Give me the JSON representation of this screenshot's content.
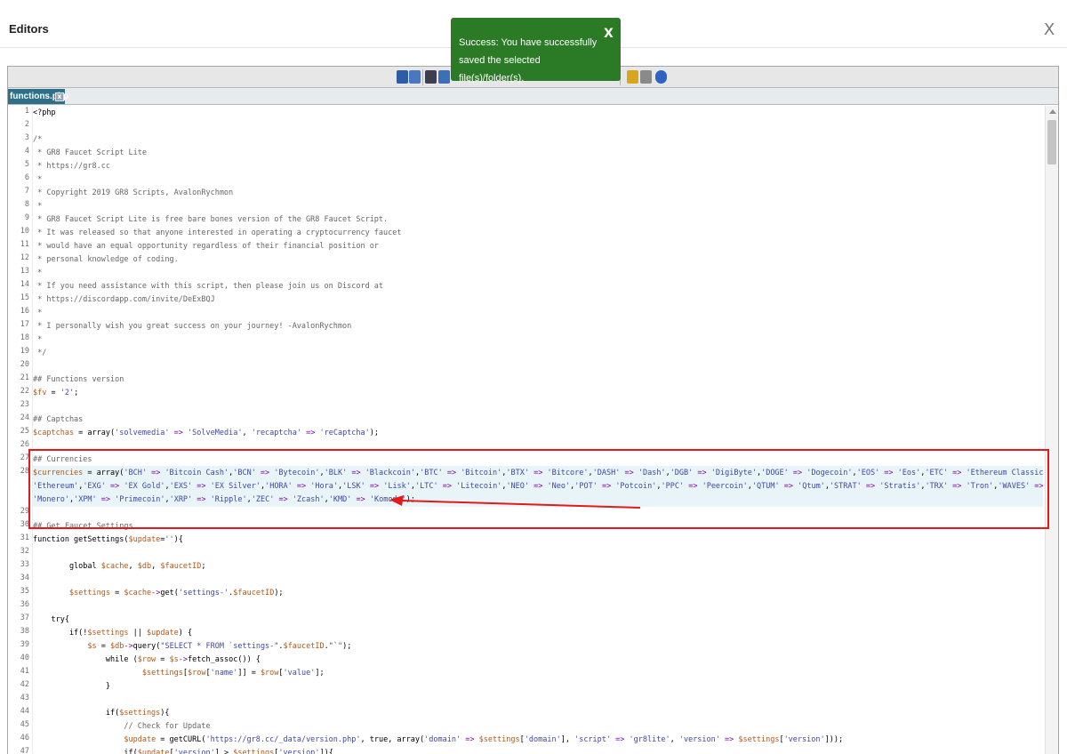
{
  "window": {
    "title": "Editors",
    "close_label": "X"
  },
  "toast": {
    "message": "Success: You have successfully saved the selected file(s)/folder(s).",
    "close_label": "X",
    "color": "#2b7a26"
  },
  "tab": {
    "label": "functions.php",
    "close_label": "x"
  },
  "toolbar_icons": [
    "save-icon",
    "save-all-icon",
    "search-icon",
    "replace-icon",
    "spellcheck-icon",
    "edit-icon",
    "help-icon"
  ],
  "highlight_color": "#e21a1a",
  "line_numbers": [
    "1",
    "2",
    "3",
    "4",
    "5",
    "6",
    "7",
    "8",
    "9",
    "10",
    "11",
    "12",
    "13",
    "14",
    "15",
    "16",
    "17",
    "18",
    "19",
    "20",
    "21",
    "22",
    "23",
    "24",
    "25",
    "26",
    "27",
    "28",
    "",
    "",
    "29",
    "30",
    "31",
    "32",
    "33",
    "34",
    "35",
    "36",
    "37",
    "38",
    "39",
    "40",
    "41",
    "42",
    "43",
    "44",
    "45",
    "46",
    "47"
  ],
  "code": [
    [
      [
        "k",
        "<?php"
      ]
    ],
    [],
    [
      [
        "c",
        "/*"
      ]
    ],
    [
      [
        "c",
        " * GR8 Faucet Script Lite"
      ]
    ],
    [
      [
        "c",
        " * https://gr8.cc"
      ]
    ],
    [
      [
        "c",
        " *"
      ]
    ],
    [
      [
        "c",
        " * Copyright 2019 GR8 Scripts, AvalonRychmon"
      ]
    ],
    [
      [
        "c",
        " *"
      ]
    ],
    [
      [
        "c",
        " * GR8 Faucet Script Lite is free bare bones version of the GR8 Faucet Script."
      ]
    ],
    [
      [
        "c",
        " * It was released so that anyone interested in operating a cryptocurrency faucet"
      ]
    ],
    [
      [
        "c",
        " * would have an equal opportunity regardless of their financial position or"
      ]
    ],
    [
      [
        "c",
        " * personal knowledge of coding."
      ]
    ],
    [
      [
        "c",
        " *"
      ]
    ],
    [
      [
        "c",
        " * If you need assistance with this script, then please join us on Discord at"
      ]
    ],
    [
      [
        "c",
        " * https://discordapp.com/invite/DeExBQJ"
      ]
    ],
    [
      [
        "c",
        " *"
      ]
    ],
    [
      [
        "c",
        " * I personally wish you great success on your journey! -AvalonRychmon"
      ]
    ],
    [
      [
        "c",
        " *"
      ]
    ],
    [
      [
        "c",
        " */"
      ]
    ],
    [],
    [
      [
        "c",
        "## Functions version"
      ]
    ],
    [
      [
        "v",
        "$fv"
      ],
      [
        "k",
        " = "
      ],
      [
        "s",
        "'2'"
      ],
      [
        "k",
        ";"
      ]
    ],
    [],
    [
      [
        "c",
        "## Captchas"
      ]
    ],
    [
      [
        "v",
        "$captchas"
      ],
      [
        "k",
        " = array("
      ],
      [
        "s",
        "'solvemedia'"
      ],
      [
        "a",
        " => "
      ],
      [
        "s",
        "'SolveMedia'"
      ],
      [
        "k",
        ", "
      ],
      [
        "s",
        "'recaptcha'"
      ],
      [
        "a",
        " => "
      ],
      [
        "s",
        "'reCaptcha'"
      ],
      [
        "k",
        ");"
      ]
    ],
    [],
    [
      [
        "c",
        "## Currencies"
      ]
    ],
    [
      [
        "v",
        "$currencies"
      ],
      [
        "k",
        " = array("
      ],
      [
        "s",
        "'BCH'"
      ],
      [
        "a",
        " => "
      ],
      [
        "s",
        "'Bitcoin Cash'"
      ],
      [
        "k",
        ","
      ],
      [
        "s",
        "'BCN'"
      ],
      [
        "a",
        " => "
      ],
      [
        "s",
        "'Bytecoin'"
      ],
      [
        "k",
        ","
      ],
      [
        "s",
        "'BLK'"
      ],
      [
        "a",
        " => "
      ],
      [
        "s",
        "'Blackcoin'"
      ],
      [
        "k",
        ","
      ],
      [
        "s",
        "'BTC'"
      ],
      [
        "a",
        " => "
      ],
      [
        "s",
        "'Bitcoin'"
      ],
      [
        "k",
        ","
      ],
      [
        "s",
        "'BTX'"
      ],
      [
        "a",
        " => "
      ],
      [
        "s",
        "'Bitcore'"
      ],
      [
        "k",
        ","
      ],
      [
        "s",
        "'DASH'"
      ],
      [
        "a",
        " => "
      ],
      [
        "s",
        "'Dash'"
      ],
      [
        "k",
        ","
      ],
      [
        "s",
        "'DGB'"
      ],
      [
        "a",
        " => "
      ],
      [
        "s",
        "'DigiByte'"
      ],
      [
        "k",
        ","
      ],
      [
        "s",
        "'DOGE'"
      ],
      [
        "a",
        " => "
      ],
      [
        "s",
        "'Dogecoin'"
      ],
      [
        "k",
        ","
      ],
      [
        "s",
        "'EOS'"
      ],
      [
        "a",
        " => "
      ],
      [
        "s",
        "'Eos'"
      ],
      [
        "k",
        ","
      ],
      [
        "s",
        "'ETC'"
      ],
      [
        "a",
        " => "
      ],
      [
        "s",
        "'Ethereum Classic'"
      ],
      [
        "k",
        ","
      ],
      [
        "s",
        "'ETH'"
      ],
      [
        "a",
        " =>"
      ]
    ],
    [
      [
        "s",
        "'Ethereum'"
      ],
      [
        "k",
        ","
      ],
      [
        "s",
        "'EXG'"
      ],
      [
        "a",
        " => "
      ],
      [
        "s",
        "'EX Gold'"
      ],
      [
        "k",
        ","
      ],
      [
        "s",
        "'EXS'"
      ],
      [
        "a",
        " => "
      ],
      [
        "s",
        "'EX Silver'"
      ],
      [
        "k",
        ","
      ],
      [
        "s",
        "'HORA'"
      ],
      [
        "a",
        " => "
      ],
      [
        "s",
        "'Hora'"
      ],
      [
        "k",
        ","
      ],
      [
        "s",
        "'LSK'"
      ],
      [
        "a",
        " => "
      ],
      [
        "s",
        "'Lisk'"
      ],
      [
        "k",
        ","
      ],
      [
        "s",
        "'LTC'"
      ],
      [
        "a",
        " => "
      ],
      [
        "s",
        "'Litecoin'"
      ],
      [
        "k",
        ","
      ],
      [
        "s",
        "'NEO'"
      ],
      [
        "a",
        " => "
      ],
      [
        "s",
        "'Neo'"
      ],
      [
        "k",
        ","
      ],
      [
        "s",
        "'POT'"
      ],
      [
        "a",
        " => "
      ],
      [
        "s",
        "'Potcoin'"
      ],
      [
        "k",
        ","
      ],
      [
        "s",
        "'PPC'"
      ],
      [
        "a",
        " => "
      ],
      [
        "s",
        "'Peercoin'"
      ],
      [
        "k",
        ","
      ],
      [
        "s",
        "'QTUM'"
      ],
      [
        "a",
        " => "
      ],
      [
        "s",
        "'Qtum'"
      ],
      [
        "k",
        ","
      ],
      [
        "s",
        "'STRAT'"
      ],
      [
        "a",
        " => "
      ],
      [
        "s",
        "'Stratis'"
      ],
      [
        "k",
        ","
      ],
      [
        "s",
        "'TRX'"
      ],
      [
        "a",
        " => "
      ],
      [
        "s",
        "'Tron'"
      ],
      [
        "k",
        ","
      ],
      [
        "s",
        "'WAVES'"
      ],
      [
        "a",
        " => "
      ],
      [
        "s",
        "'Waves'"
      ],
      [
        "k",
        ","
      ],
      [
        "s",
        "'XMR'"
      ],
      [
        "a",
        " =>"
      ]
    ],
    [
      [
        "s",
        "'Monero'"
      ],
      [
        "k",
        ","
      ],
      [
        "s",
        "'XPM'"
      ],
      [
        "a",
        " => "
      ],
      [
        "s",
        "'Primecoin'"
      ],
      [
        "k",
        ","
      ],
      [
        "s",
        "'XRP'"
      ],
      [
        "a",
        " => "
      ],
      [
        "s",
        "'Ripple'"
      ],
      [
        "k",
        ","
      ],
      [
        "s",
        "'ZEC'"
      ],
      [
        "a",
        " => "
      ],
      [
        "s",
        "'Zcash'"
      ],
      [
        "k",
        ","
      ],
      [
        "s",
        "'KMD'"
      ],
      [
        "a",
        " => "
      ],
      [
        "s",
        "'Komodo'"
      ],
      [
        "k",
        ");"
      ]
    ],
    [],
    [
      [
        "c",
        "## Get Faucet Settings"
      ]
    ],
    [
      [
        "k",
        "function getSettings("
      ],
      [
        "v",
        "$update"
      ],
      [
        "k",
        "="
      ],
      [
        "s",
        "''"
      ],
      [
        "k",
        "){"
      ]
    ],
    [],
    [
      [
        "k",
        "        global "
      ],
      [
        "v",
        "$cache"
      ],
      [
        "k",
        ", "
      ],
      [
        "v",
        "$db"
      ],
      [
        "k",
        ", "
      ],
      [
        "v",
        "$faucetID"
      ],
      [
        "k",
        ";"
      ]
    ],
    [],
    [
      [
        "k",
        "        "
      ],
      [
        "v",
        "$settings"
      ],
      [
        "k",
        " = "
      ],
      [
        "v",
        "$cache"
      ],
      [
        "a",
        "->"
      ],
      [
        "k",
        "get("
      ],
      [
        "s",
        "'settings-'"
      ],
      [
        "k",
        "."
      ],
      [
        "v",
        "$faucetID"
      ],
      [
        "k",
        ");"
      ]
    ],
    [],
    [
      [
        "k",
        "    try{"
      ]
    ],
    [
      [
        "k",
        "        if(!"
      ],
      [
        "v",
        "$settings"
      ],
      [
        "k",
        " || "
      ],
      [
        "v",
        "$update"
      ],
      [
        "k",
        ") {"
      ]
    ],
    [
      [
        "k",
        "            "
      ],
      [
        "v",
        "$s"
      ],
      [
        "k",
        " = "
      ],
      [
        "v",
        "$db"
      ],
      [
        "a",
        "->"
      ],
      [
        "k",
        "query("
      ],
      [
        "s",
        "\"SELECT * FROM `settings-\""
      ],
      [
        "k",
        "."
      ],
      [
        "v",
        "$faucetID"
      ],
      [
        "k",
        "."
      ],
      [
        "s",
        "\"`\""
      ],
      [
        "k",
        ");"
      ]
    ],
    [
      [
        "k",
        "                while ("
      ],
      [
        "v",
        "$row"
      ],
      [
        "k",
        " = "
      ],
      [
        "v",
        "$s"
      ],
      [
        "a",
        "->"
      ],
      [
        "k",
        "fetch_assoc()) {"
      ]
    ],
    [
      [
        "k",
        "                        "
      ],
      [
        "v",
        "$settings"
      ],
      [
        "k",
        "["
      ],
      [
        "v",
        "$row"
      ],
      [
        "k",
        "["
      ],
      [
        "s",
        "'name'"
      ],
      [
        "k",
        "]] = "
      ],
      [
        "v",
        "$row"
      ],
      [
        "k",
        "["
      ],
      [
        "s",
        "'value'"
      ],
      [
        "k",
        "];"
      ]
    ],
    [
      [
        "k",
        "                }"
      ]
    ],
    [],
    [
      [
        "k",
        "                if("
      ],
      [
        "v",
        "$settings"
      ],
      [
        "k",
        "){"
      ]
    ],
    [
      [
        "c",
        "                    // Check for Update"
      ]
    ],
    [
      [
        "k",
        "                    "
      ],
      [
        "v",
        "$update"
      ],
      [
        "k",
        " = getCURL("
      ],
      [
        "s",
        "'https://gr8.cc/_data/version.php'"
      ],
      [
        "k",
        ", true, array("
      ],
      [
        "s",
        "'domain'"
      ],
      [
        "a",
        " => "
      ],
      [
        "v",
        "$settings"
      ],
      [
        "k",
        "["
      ],
      [
        "s",
        "'domain'"
      ],
      [
        "k",
        "], "
      ],
      [
        "s",
        "'script'"
      ],
      [
        "a",
        " => "
      ],
      [
        "s",
        "'gr8lite'"
      ],
      [
        "k",
        ", "
      ],
      [
        "s",
        "'version'"
      ],
      [
        "a",
        " => "
      ],
      [
        "v",
        "$settings"
      ],
      [
        "k",
        "["
      ],
      [
        "s",
        "'version'"
      ],
      [
        "k",
        "]));"
      ]
    ],
    [
      [
        "k",
        "                    if("
      ],
      [
        "v",
        "$update"
      ],
      [
        "k",
        "["
      ],
      [
        "s",
        "'version'"
      ],
      [
        "k",
        "] > "
      ],
      [
        "v",
        "$settings"
      ],
      [
        "k",
        "["
      ],
      [
        "s",
        "'version'"
      ],
      [
        "k",
        "]){"
      ]
    ]
  ]
}
